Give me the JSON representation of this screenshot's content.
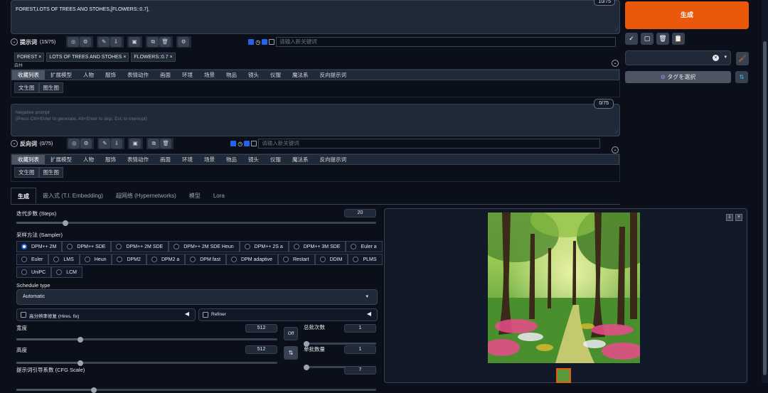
{
  "prompt": {
    "text": "FOREST,LOTS OF TREES ANO STOHES,[FLOWERS::0.7],",
    "counter": "10/75",
    "label": "提示词",
    "count": "(15/75)",
    "keyword_placeholder": "请输入新关键词",
    "tags": [
      "FOREST",
      "LOTS OF TREES AND STOHES",
      "FLOWERS::0.7"
    ],
    "tag_sub": [
      "森林",
      "",
      ""
    ]
  },
  "categories": [
    "收藏列表",
    "扩展模型",
    "人物",
    "服饰",
    "表情动作",
    "画面",
    "环境",
    "场景",
    "物品",
    "镜头",
    "仪服",
    "魔法系",
    "反向提示词"
  ],
  "subcategories": [
    "文生图",
    "图生图"
  ],
  "negative": {
    "placeholder": "Negative prompt\n(Press Ctrl+Enter to generate, Alt+Enter to skip, Esc to interrupt)",
    "counter": "0/75",
    "label": "反向词",
    "count": "(0/75)",
    "keyword_placeholder": "请输入新关键词"
  },
  "right": {
    "generate": "生成",
    "select_tags": "タグを選択"
  },
  "tabs": [
    "生成",
    "嵌入式 (T.I. Embedding)",
    "超网络 (Hypernetworks)",
    "模型",
    "Lora"
  ],
  "params": {
    "steps_label": "迭代步数 (Steps)",
    "steps_value": "20",
    "sampler_label": "采样方法 (Sampler)",
    "samplers_row1": [
      "DPM++ 2M",
      "DPM++ SDE",
      "DPM++ 2M SDE",
      "DPM++ 2M SDE Heun",
      "DPM++ 2S a",
      "DPM++ 3M SDE",
      "Euler a"
    ],
    "samplers_row2": [
      "Euler",
      "LMS",
      "Heun",
      "DPM2",
      "DPM2 a",
      "DPM fast",
      "DPM adaptive",
      "Restart",
      "DDIM",
      "PLMS"
    ],
    "samplers_row3": [
      "UniPC",
      "LCM"
    ],
    "schedule_label": "Schedule type",
    "schedule_value": "Automatic",
    "hires_label": "高分辨率修复 (Hires. fix)",
    "refiner_label": "Refiner",
    "width_label": "宽度",
    "width_value": "512",
    "height_label": "高度",
    "height_value": "512",
    "batch_count_label": "总批次数",
    "batch_count_value": "1",
    "batch_size_label": "单批数量",
    "batch_size_value": "1",
    "off_label": "Off",
    "cfg_label": "提示词引导系数 (CFG Scale)",
    "cfg_value": "7",
    "steps_fraction": 0.13,
    "width_fraction": 0.24,
    "height_fraction": 0.24,
    "batch_count_fraction": 0.0,
    "batch_size_fraction": 0.0,
    "cfg_fraction": 0.21
  },
  "colors": {
    "accent": "#ea580c",
    "selected": "#2563eb",
    "select_tag": "#4b5563"
  }
}
